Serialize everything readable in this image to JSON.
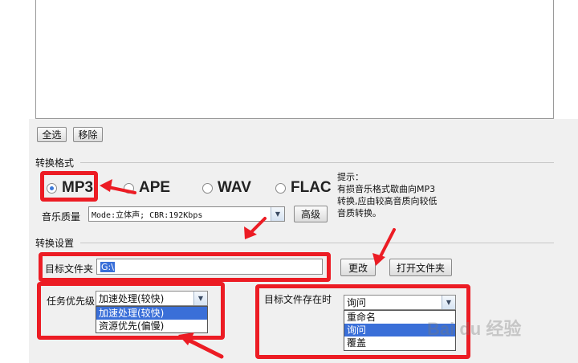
{
  "toolbar": {
    "select_all": "全选",
    "remove": "移除"
  },
  "format_group": {
    "title": "转换格式",
    "options": [
      {
        "label": "MP3",
        "selected": true
      },
      {
        "label": "APE",
        "selected": false
      },
      {
        "label": "WAV",
        "selected": false
      },
      {
        "label": "FLAC",
        "selected": false
      }
    ],
    "quality_label": "音乐质量",
    "quality_value": "Mode:立体声; CBR:192Kbps",
    "advanced_button": "高级",
    "hint": "提示：\n  有损音乐格式歇曲向MP3\n转换,应由较高音质向较低\n音质转换。"
  },
  "settings_group": {
    "title": "转换设置",
    "target_folder_label": "目标文件夹",
    "target_folder_value": "G:\\",
    "change_button": "更改",
    "open_folder_button": "打开文件夹",
    "priority_label": "任务优先级",
    "priority_value": "加速处理(较快)",
    "priority_options": [
      "加速处理(较快)",
      "资源优先(偏慢)"
    ],
    "exists_label": "目标文件存在时",
    "exists_value": "询问",
    "exists_options": [
      "重命名",
      "询问",
      "覆盖"
    ]
  },
  "watermark": "Bai du 经验",
  "colors": {
    "annotation_red": "#ec1c24",
    "selection_blue": "#3a6fd8"
  }
}
